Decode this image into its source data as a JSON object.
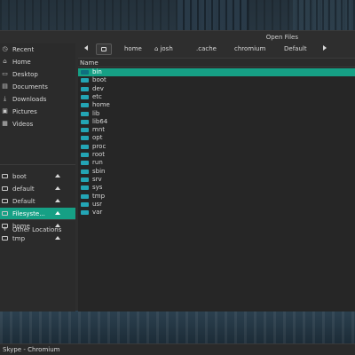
{
  "window": {
    "title": "Open Files"
  },
  "sidebar": {
    "places": [
      {
        "label": "Recent",
        "icon": "recent-icon",
        "glyph": "◷"
      },
      {
        "label": "Home",
        "icon": "home-icon",
        "glyph": "⌂"
      },
      {
        "label": "Desktop",
        "icon": "desktop-icon",
        "glyph": "▭"
      },
      {
        "label": "Documents",
        "icon": "documents-icon",
        "glyph": "▤"
      },
      {
        "label": "Downloads",
        "icon": "downloads-icon",
        "glyph": "⤓"
      },
      {
        "label": "Pictures",
        "icon": "pictures-icon",
        "glyph": "▣"
      },
      {
        "label": "Videos",
        "icon": "videos-icon",
        "glyph": "▦"
      }
    ],
    "devices": [
      {
        "label": "boot",
        "ejectable": true,
        "selected": false
      },
      {
        "label": "default",
        "ejectable": true,
        "selected": false
      },
      {
        "label": "Default",
        "ejectable": true,
        "selected": false
      },
      {
        "label": "Filesyste...",
        "ejectable": true,
        "selected": true
      },
      {
        "label": "home",
        "ejectable": true,
        "selected": false
      },
      {
        "label": "tmp",
        "ejectable": true,
        "selected": false
      }
    ],
    "other_locations": {
      "label": "Other Locations",
      "glyph": "+"
    }
  },
  "pathbar": {
    "crumbs": [
      "home",
      "josh",
      ".cache",
      "chromium",
      "Default"
    ],
    "home_glyph": "⌂"
  },
  "filelist": {
    "column_name": "Name",
    "selected_index": 0,
    "items": [
      "bin",
      "boot",
      "dev",
      "etc",
      "home",
      "lib",
      "lib64",
      "mnt",
      "opt",
      "proc",
      "root",
      "run",
      "sbin",
      "srv",
      "sys",
      "tmp",
      "usr",
      "var"
    ]
  },
  "taskbar": {
    "active_task": "Skype - Chromium"
  },
  "colors": {
    "accent": "#16a085",
    "folder": "#23a5b5",
    "dialog_bg": "#2e2e2e"
  }
}
